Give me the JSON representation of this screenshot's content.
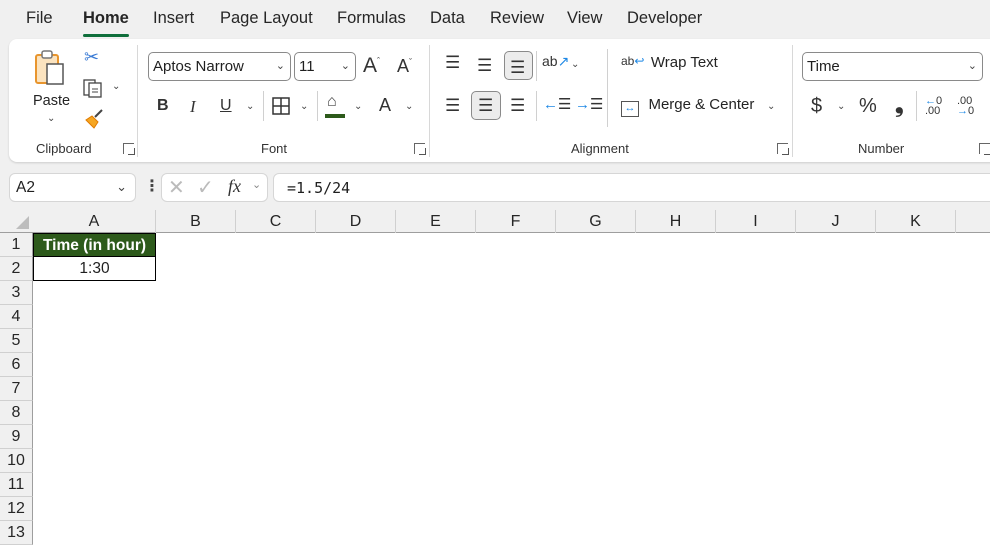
{
  "menu": {
    "tabs": [
      {
        "label": "File"
      },
      {
        "label": "Home",
        "active": true
      },
      {
        "label": "Insert"
      },
      {
        "label": "Page Layout"
      },
      {
        "label": "Formulas"
      },
      {
        "label": "Data"
      },
      {
        "label": "Review"
      },
      {
        "label": "View"
      },
      {
        "label": "Developer"
      }
    ]
  },
  "ribbon": {
    "clipboard": {
      "label": "Clipboard",
      "paste_label": "Paste"
    },
    "font": {
      "label": "Font",
      "font_name": "Aptos Narrow",
      "font_size": "11",
      "bold": "B",
      "italic": "I",
      "underline": "U",
      "font_color_glyph": "A",
      "fill_color": "#2d5a1b"
    },
    "alignment": {
      "label": "Alignment",
      "wrap_text": "Wrap Text",
      "merge_center": "Merge & Center"
    },
    "number": {
      "label": "Number",
      "format": "Time",
      "currency": "$",
      "percent": "%",
      "comma": "❟",
      "inc_decimal": ".00",
      "dec_decimal": ".00"
    }
  },
  "formula_bar": {
    "name_box": "A2",
    "fx": "fx",
    "formula": "=1.5/24"
  },
  "sheet": {
    "columns": [
      "A",
      "B",
      "C",
      "D",
      "E",
      "F",
      "G",
      "H",
      "I",
      "J",
      "K"
    ],
    "rows": [
      "1",
      "2",
      "3",
      "4",
      "5",
      "6",
      "7",
      "8",
      "9",
      "10",
      "11",
      "12",
      "13"
    ],
    "cells": {
      "A1": {
        "value": "Time (in hour)",
        "bg": "#2d5a1b",
        "color": "#ffffff"
      },
      "A2": {
        "value": "1:30"
      }
    }
  }
}
